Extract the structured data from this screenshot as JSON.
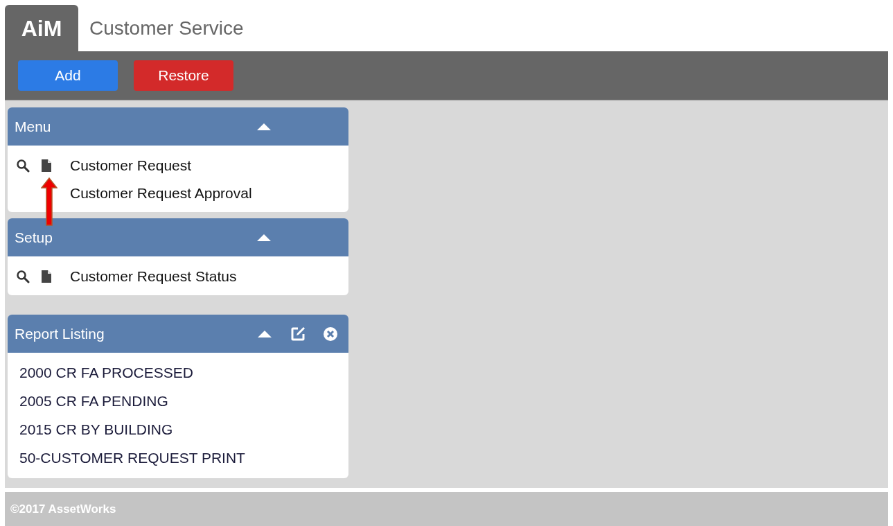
{
  "app": {
    "logo": "AiM",
    "title": "Customer Service"
  },
  "toolbar": {
    "buttons": [
      {
        "label": "Add",
        "kind": "primary"
      },
      {
        "label": "Restore",
        "kind": "danger"
      }
    ]
  },
  "panels": [
    {
      "title": "Menu",
      "expanded": true,
      "kind": "menu",
      "items": [
        {
          "label": "Customer Request",
          "kind": "actions"
        },
        {
          "label": "Customer Request Approval",
          "kind": "plain"
        }
      ]
    },
    {
      "title": "Setup",
      "expanded": true,
      "kind": "menu",
      "items": [
        {
          "label": "Customer Request Status",
          "kind": "actions"
        }
      ]
    },
    {
      "title": "Report Listing",
      "expanded": true,
      "kind": "reports",
      "items": [
        {
          "label": "2000 CR FA PROCESSED"
        },
        {
          "label": "2005 CR FA PENDING"
        },
        {
          "label": "2015 CR BY BUILDING"
        },
        {
          "label": "50-CUSTOMER REQUEST PRINT"
        }
      ]
    }
  ],
  "footer": "©2017 AssetWorks"
}
